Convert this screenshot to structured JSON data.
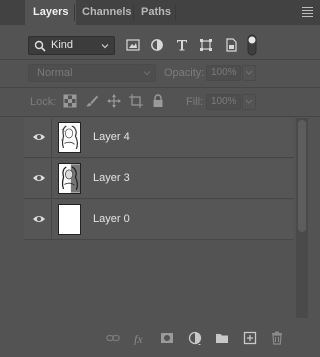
{
  "tabs": [
    {
      "label": "Layers",
      "active": true
    },
    {
      "label": "Channels",
      "active": false
    },
    {
      "label": "Paths",
      "active": false
    }
  ],
  "panel_menu_icon": "hamburger-menu-icon",
  "filter": {
    "kind_label": "Kind",
    "icons": [
      "pixel-layer-filter-icon",
      "adjustment-layer-filter-icon",
      "type-layer-filter-icon",
      "shape-layer-filter-icon",
      "smart-object-filter-icon",
      "filter-toggle-icon"
    ]
  },
  "blend": {
    "mode": "Normal",
    "opacity_label": "Opacity:",
    "opacity_value": "100%"
  },
  "lock": {
    "label": "Lock:",
    "icons": [
      "lock-transparent-pixels-icon",
      "lock-image-pixels-icon",
      "lock-position-icon",
      "lock-artboard-icon",
      "lock-all-icon"
    ],
    "fill_label": "Fill:",
    "fill_value": "100%"
  },
  "layers": [
    {
      "name": "Layer 4",
      "visible": true,
      "thumbnail": "portrait-sketch"
    },
    {
      "name": "Layer 3",
      "visible": true,
      "thumbnail": "portrait-sketch"
    },
    {
      "name": "Layer 0",
      "visible": true,
      "thumbnail": "white"
    }
  ],
  "bottom_toolbar": [
    "link-layers-icon",
    "layer-style-fx-icon",
    "add-mask-icon",
    "adjustment-layer-icon",
    "new-group-folder-icon",
    "new-layer-icon",
    "delete-layer-trash-icon"
  ],
  "colors": {
    "panel_bg": "#535353",
    "tabbar_bg": "#424242",
    "text": "#e4e4e4"
  }
}
